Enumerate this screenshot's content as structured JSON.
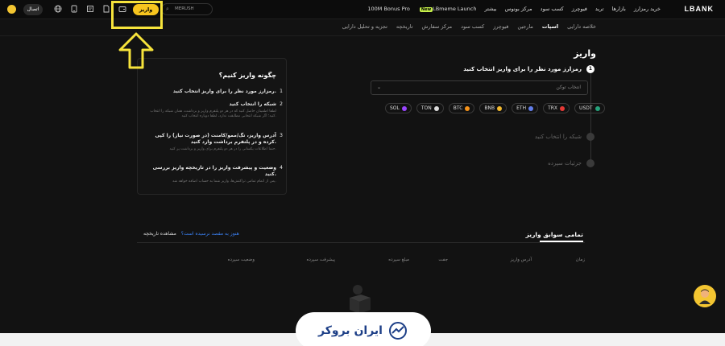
{
  "topbar": {
    "logo": "LBANK",
    "nav": [
      "خرید رمزارز",
      "بازارها",
      "ترید",
      "فیوچرز",
      "کسب سود",
      "مرکز بونوس",
      "بیشتر",
      "LBmeme Launch",
      "100M Bonus Pro"
    ],
    "nav_badge": "New",
    "search_placeholder": "MERUSH",
    "deposit_label": "واریز",
    "connect_label": "اتصال"
  },
  "subnav": {
    "items": [
      "خلاصه دارایی",
      "اسپات",
      "مارجین",
      "فیوچرز",
      "کسب سود",
      "مرکز سفارش",
      "تاریخچه",
      "تجزیه و تحلیل دارایی"
    ],
    "active_index": 1
  },
  "main": {
    "title": "واریز",
    "steps": [
      {
        "number": "1",
        "label": "رمزارز مورد نظر را برای واریز انتخاب کنید",
        "active": true
      },
      {
        "label": "شبکه را انتخاب کنید",
        "active": false
      },
      {
        "label": "جزئیات سپرده",
        "active": false
      }
    ],
    "token_select_placeholder": "انتخاب توکن",
    "coins": [
      {
        "symbol": "USDT",
        "color": "#26a17b"
      },
      {
        "symbol": "TRX",
        "color": "#e53935"
      },
      {
        "symbol": "ETH",
        "color": "#627eea"
      },
      {
        "symbol": "BNB",
        "color": "#f3ba2f"
      },
      {
        "symbol": "BTC",
        "color": "#f7931a"
      },
      {
        "symbol": "TON",
        "color": "#dddddd"
      },
      {
        "symbol": "SOL",
        "color": "#9945ff"
      }
    ]
  },
  "howto": {
    "title": "چگونه واریز کنیم؟",
    "items": [
      {
        "n": "1",
        "title": "رمزارز مورد نظر را برای واریز انتخاب کنید.",
        "desc": ""
      },
      {
        "n": "2",
        "title": "شبکه را انتخاب کنید",
        "desc": "لطفا اطمینان حاصل کنید که در هر دو پلتفرم واریز و برداشت، همان شبکه را انتخاب کنید؛ اگر شبکه انتخابی مطابقت ندارد، لطفا دوباره انتخاب کنید."
      },
      {
        "n": "3",
        "title": "آدرس واریز، تگ/ممو/کامنت (در صورت نیاز) را کپی کرده و در پلتفرم برداشت وارد کنید.",
        "desc": "حتما اطلاعات یکسانی را در هر دو پلتفرم برای واریز و برداشت پر کنید."
      },
      {
        "n": "4",
        "title": "وضعیت و پیشرفت واریز را در تاریخچه واریز بررسی کنید.",
        "desc": "پس از اتمام تمامی تراکنش‌ها، واریز شما به حساب اضافه خواهد شد."
      }
    ]
  },
  "history": {
    "tab_label": "تمامی سوابق واریز",
    "not_arrived": "هنوز به مقصد نرسیده است؟",
    "view_history": "مشاهده تاریخچه",
    "columns": [
      "زمان",
      "آدرس واریز",
      "جفت",
      "مبلغ سپرده",
      "پیشرفت سپرده",
      "وضعیت سپرده"
    ]
  },
  "brand": {
    "name": "ایران بروکر"
  },
  "colors": {
    "accent": "#f7c51e",
    "annotation": "#f6e33b",
    "brand": "#1d3f87"
  }
}
